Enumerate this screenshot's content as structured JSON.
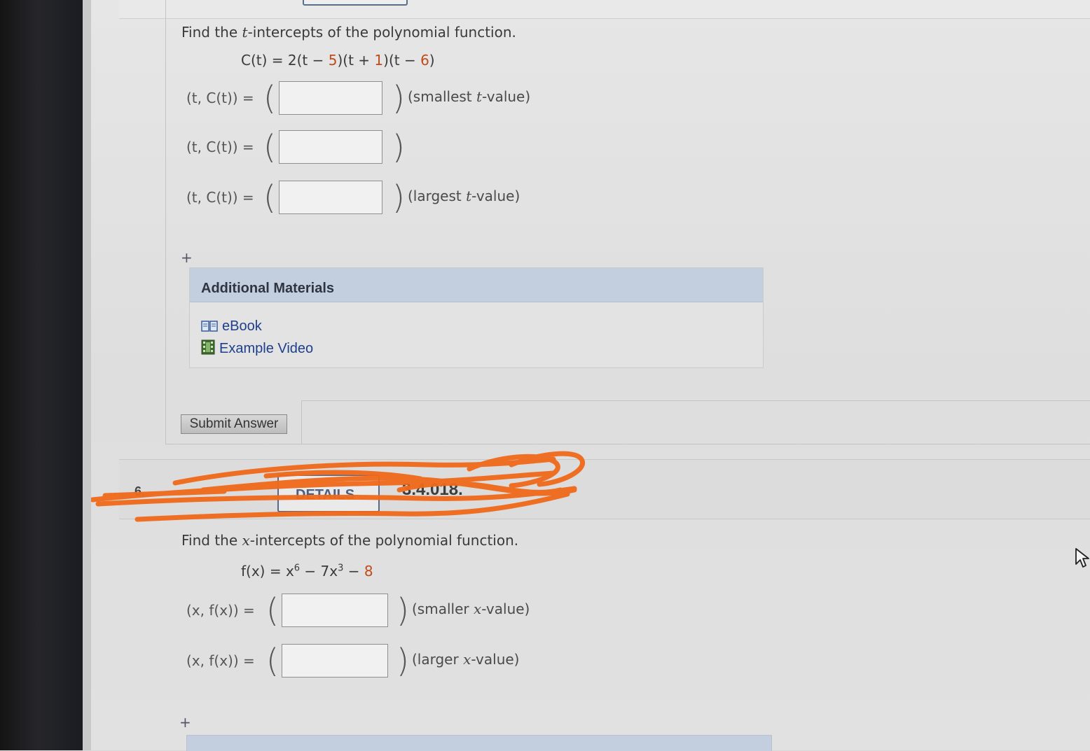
{
  "question5": {
    "prompt_parts": [
      "Find the ",
      "t",
      "-intercepts of the polynomial function."
    ],
    "equation": {
      "lhs": "C(t) = 2(t",
      "p1": " − ",
      "n1": "5",
      "p2": ")(t + ",
      "n2": "1",
      "p3": ")(t − ",
      "n3": "6",
      "p4": ")"
    },
    "rows": [
      {
        "label": "(t, C(t))  =",
        "hint_pre": "(smallest ",
        "hint_var": "t",
        "hint_post": "-value)",
        "value": ""
      },
      {
        "label": "(t, C(t))  =",
        "hint_pre": "",
        "hint_var": "",
        "hint_post": "",
        "value": ""
      },
      {
        "label": "(t, C(t))  =",
        "hint_pre": "(largest ",
        "hint_var": "t",
        "hint_post": "-value)",
        "value": ""
      }
    ],
    "plus_symbol": "+",
    "additional_materials": {
      "title": "Additional Materials",
      "items": [
        {
          "label": "eBook",
          "icon": "book-icon"
        },
        {
          "label": "Example Video",
          "icon": "video-icon"
        }
      ]
    },
    "submit_label": "Submit Answer"
  },
  "question6": {
    "number": "6.",
    "details_label": "DETAILS",
    "reference": "3.4.018.",
    "prompt_parts": [
      "Find the ",
      "x",
      "-intercepts of the polynomial function."
    ],
    "equation": {
      "lhs": "f(x) = x",
      "exp1": "6",
      "mid": " − 7x",
      "exp2": "3",
      "tail": " − ",
      "n": "8"
    },
    "rows": [
      {
        "label": "(x, f(x))  =",
        "hint_pre": "(smaller ",
        "hint_var": "x",
        "hint_post": "-value)",
        "value": ""
      },
      {
        "label": "(x, f(x))  =",
        "hint_pre": "(larger ",
        "hint_var": "x",
        "hint_post": "-value)",
        "value": ""
      }
    ],
    "plus_symbol": "+"
  },
  "colors": {
    "accent_blue": "#1e3f8a",
    "materials_header": "#c3cfdf",
    "scribble_orange": "#f06a1a",
    "equation_number": "#c14a1c"
  }
}
